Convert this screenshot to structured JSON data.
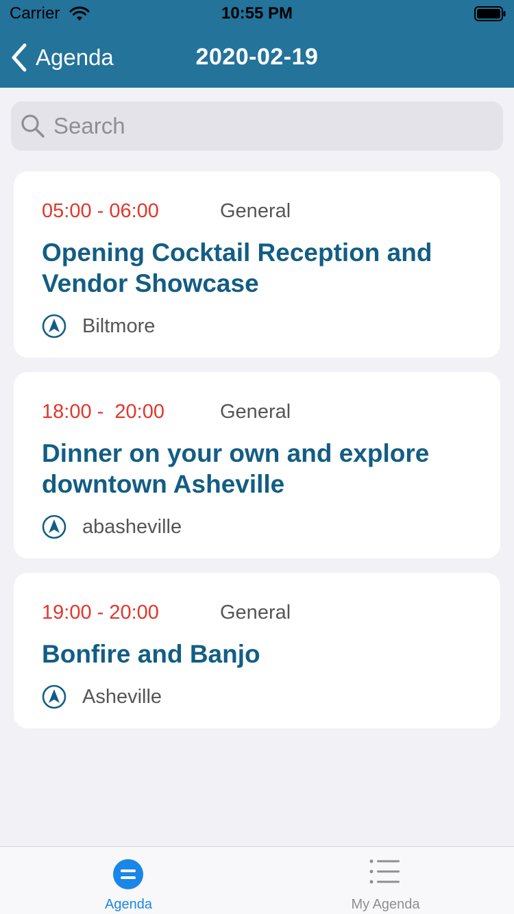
{
  "status_bar": {
    "carrier": "Carrier",
    "time": "10:55 PM"
  },
  "nav": {
    "back_label": "Agenda",
    "title": "2020-02-19"
  },
  "search": {
    "placeholder": "Search",
    "value": ""
  },
  "events": [
    {
      "time": "05:00 - 06:00",
      "category": "General",
      "title": "Opening Cocktail Reception and Vendor Showcase",
      "location": "Biltmore"
    },
    {
      "time": "18:00 -  20:00",
      "category": "General",
      "title": "Dinner on your own and explore downtown Asheville",
      "location": "abasheville"
    },
    {
      "time": "19:00 - 20:00",
      "category": "General",
      "title": "Bonfire and Banjo",
      "location": "Asheville"
    }
  ],
  "tabs": [
    {
      "label": "Agenda",
      "icon": "agenda-circle-icon",
      "active": true
    },
    {
      "label": "My Agenda",
      "icon": "list-icon",
      "active": false
    }
  ],
  "colors": {
    "header": "#23739b",
    "title": "#125d84",
    "time": "#e2362a",
    "active_tab": "#1a86e8",
    "inactive_tab": "#8e8e93",
    "background": "#f1f1f6"
  }
}
